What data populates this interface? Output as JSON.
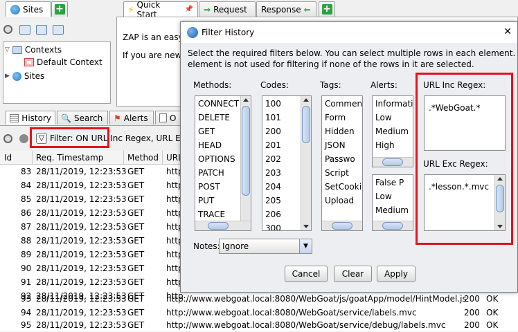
{
  "top_tabs": {
    "sites": "Sites",
    "quick_start": "Quick Start",
    "request": "Request",
    "response": "Response"
  },
  "sites_tree": {
    "contexts": "Contexts",
    "default_context": "Default Context",
    "sites": "Sites"
  },
  "quickstart_text": {
    "line1": "ZAP is an easy",
    "line2": "If you are new to"
  },
  "bottom_tabs": {
    "history": "History",
    "search": "Search",
    "alerts": "Alerts",
    "output": "O"
  },
  "filter_bar": {
    "text": "Filter: ON URL Inc Regex, URL Exc"
  },
  "table": {
    "headers": [
      "Id",
      "Req. Timestamp",
      "Method",
      "URL"
    ],
    "rows": [
      {
        "id": "83",
        "ts": "28/11/2019, 12:23:53",
        "method": "GET",
        "url": "http",
        "code": "",
        "reason": ""
      },
      {
        "id": "84",
        "ts": "28/11/2019, 12:23:53",
        "method": "GET",
        "url": "http",
        "code": "",
        "reason": ""
      },
      {
        "id": "85",
        "ts": "28/11/2019, 12:23:53",
        "method": "GET",
        "url": "http",
        "code": "",
        "reason": ""
      },
      {
        "id": "86",
        "ts": "28/11/2019, 12:23:53",
        "method": "GET",
        "url": "http",
        "code": "",
        "reason": ""
      },
      {
        "id": "87",
        "ts": "28/11/2019, 12:23:53",
        "method": "GET",
        "url": "http",
        "code": "",
        "reason": ""
      },
      {
        "id": "88",
        "ts": "28/11/2019, 12:23:53",
        "method": "GET",
        "url": "http",
        "code": "",
        "reason": ""
      },
      {
        "id": "89",
        "ts": "28/11/2019, 12:23:53",
        "method": "GET",
        "url": "http",
        "code": "",
        "reason": ""
      },
      {
        "id": "90",
        "ts": "28/11/2019, 12:23:53",
        "method": "GET",
        "url": "http",
        "code": "",
        "reason": ""
      },
      {
        "id": "91",
        "ts": "28/11/2019, 12:23:53",
        "method": "GET",
        "url": "http",
        "code": "",
        "reason": ""
      },
      {
        "id": "92",
        "ts": "28/11/2019, 12:23:53",
        "method": "GET",
        "url": "http",
        "code": "",
        "reason": ""
      },
      {
        "id": "93",
        "ts": "28/11/2019, 12:23:53",
        "method": "GET",
        "url": "http://www.webgoat.local:8080/WebGoat/js/goatApp/model/HintModel.js",
        "code": "200",
        "reason": "OK"
      },
      {
        "id": "94",
        "ts": "28/11/2019, 12:23:53",
        "method": "GET",
        "url": "http://www.webgoat.local:8080/WebGoat/service/labels.mvc",
        "code": "200",
        "reason": "OK"
      },
      {
        "id": "95",
        "ts": "28/11/2019, 12:23:53",
        "method": "GET",
        "url": "http://www.webgoat.local:8080/WebGoat/service/debug/labels.mvc",
        "code": "200",
        "reason": "OK"
      }
    ]
  },
  "dialog": {
    "title": "Filter History",
    "close": "✕",
    "instructions_1": "Select the required filters below. You can select multiple rows in each element. An",
    "instructions_2": "element is not used for filtering if none of the rows in it are selected.",
    "methods_label": "Methods:",
    "methods": [
      "CONNECT",
      "DELETE",
      "GET",
      "HEAD",
      "OPTIONS",
      "PATCH",
      "POST",
      "PUT",
      "TRACE"
    ],
    "codes_label": "Codes:",
    "codes": [
      "100",
      "101",
      "200",
      "201",
      "202",
      "203",
      "204",
      "205",
      "206",
      "300"
    ],
    "tags_label": "Tags:",
    "tags": [
      "Commen",
      "Form",
      "Hidden",
      "JSON",
      "Passwo",
      "Script",
      "SetCooki",
      "Upload"
    ],
    "alerts_label": "Alerts:",
    "alerts_risk": [
      "Informatio",
      "Low",
      "Medium",
      "High"
    ],
    "alerts_conf": [
      "False P",
      "Low",
      "Medium"
    ],
    "url_inc_label": "URL Inc Regex:",
    "url_inc_value": ".*WebGoat.*",
    "url_exc_label": "URL Exc Regex:",
    "url_exc_value": ".*lesson.*.mvc",
    "notes_label": "Notes:",
    "notes_value": "Ignore",
    "cancel": "Cancel",
    "clear": "Clear",
    "apply": "Apply"
  },
  "colors": {
    "highlight_red": "#e0141e",
    "plus_green": "#2ea043"
  }
}
